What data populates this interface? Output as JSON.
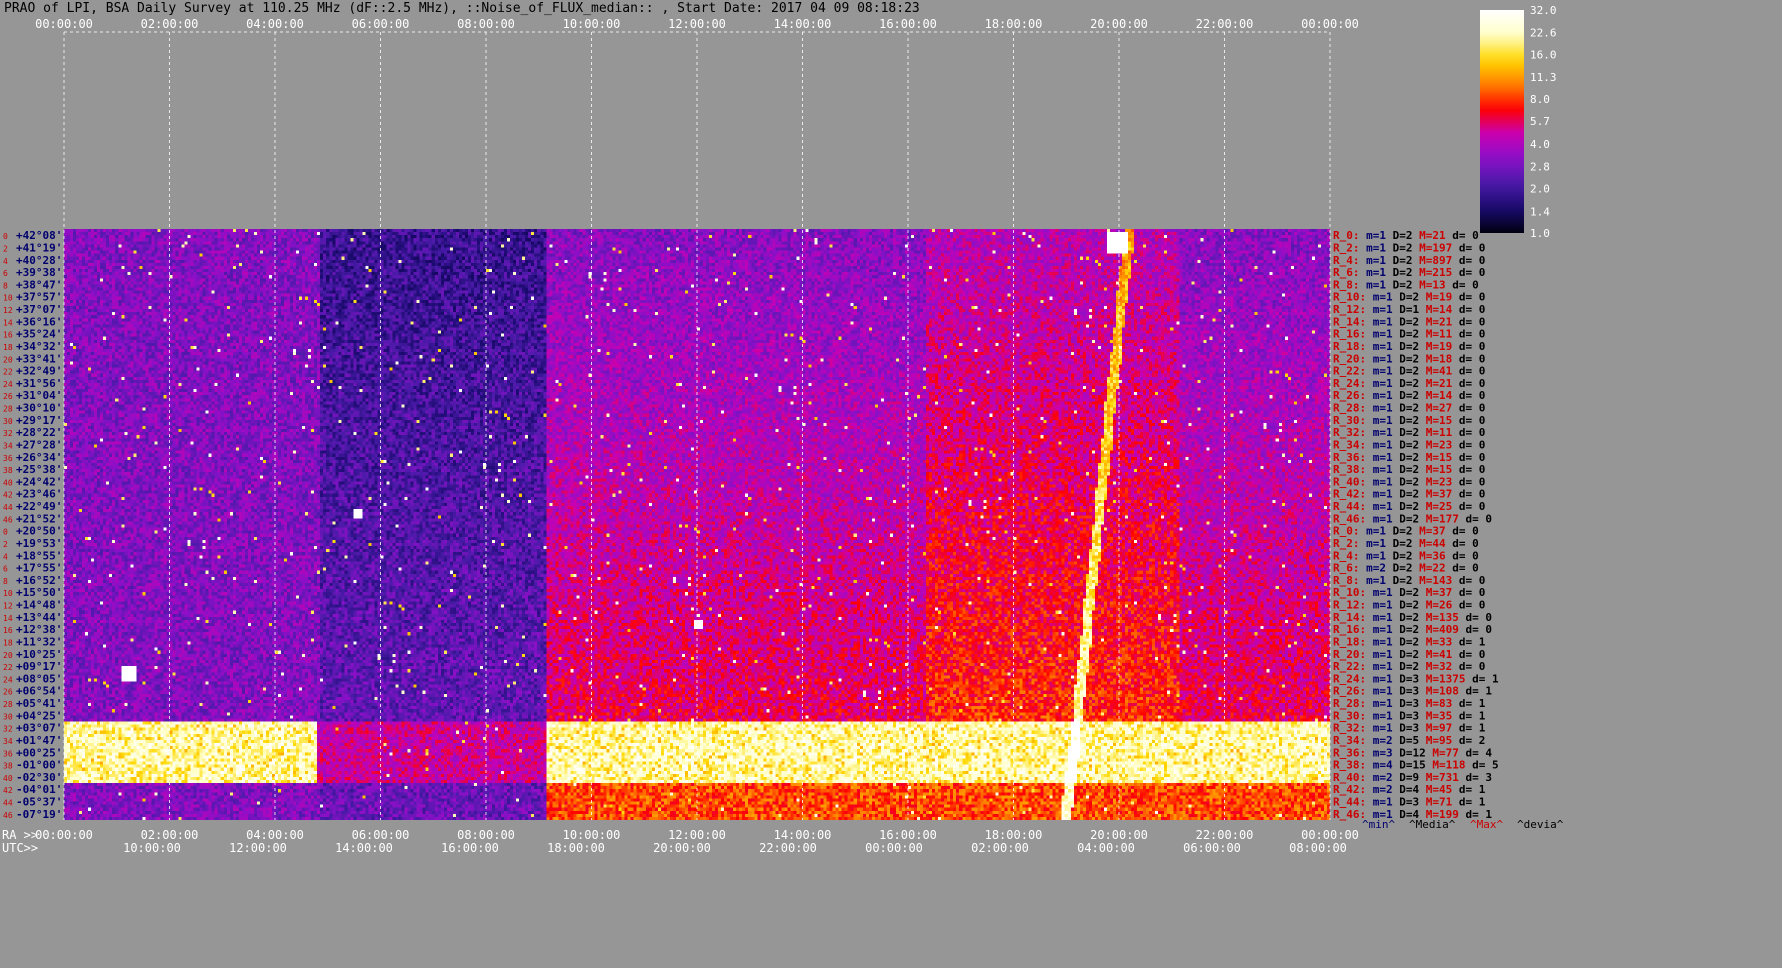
{
  "title": "PRAO of LPI, BSA Daily Survey at 110.25 MHz (dF::2.5 MHz), ::Noise_of_FLUX_median:: , Start Date: 2017 04 09 08:18:23",
  "colors": {
    "background": "#969696",
    "label_red": "#cc0000",
    "label_navy": "#00006e",
    "colorscale": [
      "#000010",
      "#1a0a6e",
      "#4a1aa8",
      "#8a10c8",
      "#c800b4",
      "#ff0000",
      "#ff8000",
      "#ffd800",
      "#ffffc8",
      "#ffffff"
    ]
  },
  "chart_data": {
    "type": "heatmap",
    "title": "PRAO of LPI, BSA Daily Survey at 110.25 MHz (dF::2.5 MHz), ::Noise_of_FLUX_median:: , Start Date: 2017 04 09 08:18:23",
    "x_top_ticks": [
      "00:00:00",
      "02:00:00",
      "04:00:00",
      "06:00:00",
      "08:00:00",
      "10:00:00",
      "12:00:00",
      "14:00:00",
      "16:00:00",
      "18:00:00",
      "20:00:00",
      "22:00:00",
      "00:00:00"
    ],
    "x_ra_label": "RA >>",
    "x_ra_ticks": [
      "00:00:00",
      "02:00:00",
      "04:00:00",
      "06:00:00",
      "08:00:00",
      "10:00:00",
      "12:00:00",
      "14:00:00",
      "16:00:00",
      "18:00:00",
      "20:00:00",
      "22:00:00",
      "00:00:00"
    ],
    "x_utc_label": "UTC>>",
    "x_utc_ticks": [
      "10:00:00",
      "12:00:00",
      "14:00:00",
      "16:00:00",
      "18:00:00",
      "20:00:00",
      "22:00:00",
      "00:00:00",
      "02:00:00",
      "04:00:00",
      "06:00:00",
      "08:00:00"
    ],
    "declinations": [
      "+42°08'",
      "+41°19'",
      "+40°28'",
      "+39°38'",
      "+38°47'",
      "+37°57'",
      "+37°07'",
      "+36°16'",
      "+35°24'",
      "+34°32'",
      "+33°41'",
      "+32°49'",
      "+31°56'",
      "+31°04'",
      "+30°10'",
      "+29°17'",
      "+28°22'",
      "+27°28'",
      "+26°34'",
      "+25°38'",
      "+24°42'",
      "+23°46'",
      "+22°49'",
      "+21°52'",
      "+20°50'",
      "+19°53'",
      "+18°55'",
      "+17°55'",
      "+16°52'",
      "+15°50'",
      "+14°48'",
      "+13°44'",
      "+12°38'",
      "+11°32'",
      "+10°25'",
      "+09°17'",
      "+08°05'",
      "+06°54'",
      "+05°41'",
      "+04°25'",
      "+03°07'",
      "+01°47'",
      "+00°25'",
      "-01°00'",
      "-02°30'",
      "-04°01'",
      "-05°37'",
      "-07°19'"
    ],
    "row_indices": [
      "0",
      "2",
      "4",
      "6",
      "8",
      "10",
      "12",
      "14",
      "16",
      "18",
      "20",
      "22",
      "24",
      "26",
      "28",
      "30",
      "32",
      "34",
      "36",
      "38",
      "40",
      "42",
      "44",
      "46",
      "0",
      "2",
      "4",
      "6",
      "8",
      "10",
      "12",
      "14",
      "16",
      "18",
      "20",
      "22",
      "24",
      "26",
      "28",
      "30",
      "32",
      "34",
      "36",
      "38",
      "40",
      "42",
      "44",
      "46"
    ],
    "colorbar_ticks": [
      "32.0",
      "22.6",
      "16.0",
      "11.3",
      "8.0",
      "5.7",
      "4.0",
      "2.8",
      "2.0",
      "1.4",
      "1.0"
    ],
    "colorbar_range": [
      1.0,
      32.0
    ],
    "colorbar_scale": "log",
    "stats_legend": [
      "^min^",
      "^Media^",
      "^Max^",
      "^devia^"
    ],
    "stats": [
      {
        "r": "R_0:",
        "m": "m=1",
        "D": "D=2",
        "M": "M=21",
        "d": "d= 0"
      },
      {
        "r": "R_2:",
        "m": "m=1",
        "D": "D=2",
        "M": "M=197",
        "d": "d= 0"
      },
      {
        "r": "R_4:",
        "m": "m=1",
        "D": "D=2",
        "M": "M=897",
        "d": "d= 0"
      },
      {
        "r": "R_6:",
        "m": "m=1",
        "D": "D=2",
        "M": "M=215",
        "d": "d= 0"
      },
      {
        "r": "R_8:",
        "m": "m=1",
        "D": "D=2",
        "M": "M=13",
        "d": "d= 0"
      },
      {
        "r": "R_10:",
        "m": "m=1",
        "D": "D=2",
        "M": "M=19",
        "d": "d= 0"
      },
      {
        "r": "R_12:",
        "m": "m=1",
        "D": "D=1",
        "M": "M=14",
        "d": "d= 0"
      },
      {
        "r": "R_14:",
        "m": "m=1",
        "D": "D=2",
        "M": "M=21",
        "d": "d= 0"
      },
      {
        "r": "R_16:",
        "m": "m=1",
        "D": "D=2",
        "M": "M=11",
        "d": "d= 0"
      },
      {
        "r": "R_18:",
        "m": "m=1",
        "D": "D=2",
        "M": "M=19",
        "d": "d= 0"
      },
      {
        "r": "R_20:",
        "m": "m=1",
        "D": "D=2",
        "M": "M=18",
        "d": "d= 0"
      },
      {
        "r": "R_22:",
        "m": "m=1",
        "D": "D=2",
        "M": "M=41",
        "d": "d= 0"
      },
      {
        "r": "R_24:",
        "m": "m=1",
        "D": "D=2",
        "M": "M=21",
        "d": "d= 0"
      },
      {
        "r": "R_26:",
        "m": "m=1",
        "D": "D=2",
        "M": "M=14",
        "d": "d= 0"
      },
      {
        "r": "R_28:",
        "m": "m=1",
        "D": "D=2",
        "M": "M=27",
        "d": "d= 0"
      },
      {
        "r": "R_30:",
        "m": "m=1",
        "D": "D=2",
        "M": "M=15",
        "d": "d= 0"
      },
      {
        "r": "R_32:",
        "m": "m=1",
        "D": "D=2",
        "M": "M=11",
        "d": "d= 0"
      },
      {
        "r": "R_34:",
        "m": "m=1",
        "D": "D=2",
        "M": "M=23",
        "d": "d= 0"
      },
      {
        "r": "R_36:",
        "m": "m=1",
        "D": "D=2",
        "M": "M=15",
        "d": "d= 0"
      },
      {
        "r": "R_38:",
        "m": "m=1",
        "D": "D=2",
        "M": "M=15",
        "d": "d= 0"
      },
      {
        "r": "R_40:",
        "m": "m=1",
        "D": "D=2",
        "M": "M=23",
        "d": "d= 0"
      },
      {
        "r": "R_42:",
        "m": "m=1",
        "D": "D=2",
        "M": "M=37",
        "d": "d= 0"
      },
      {
        "r": "R_44:",
        "m": "m=1",
        "D": "D=2",
        "M": "M=25",
        "d": "d= 0"
      },
      {
        "r": "R_46:",
        "m": "m=1",
        "D": "D=2",
        "M": "M=177",
        "d": "d= 0"
      },
      {
        "r": "R_0:",
        "m": "m=1",
        "D": "D=2",
        "M": "M=37",
        "d": "d= 0"
      },
      {
        "r": "R_2:",
        "m": "m=1",
        "D": "D=2",
        "M": "M=44",
        "d": "d= 0"
      },
      {
        "r": "R_4:",
        "m": "m=1",
        "D": "D=2",
        "M": "M=36",
        "d": "d= 0"
      },
      {
        "r": "R_6:",
        "m": "m=2",
        "D": "D=2",
        "M": "M=22",
        "d": "d= 0"
      },
      {
        "r": "R_8:",
        "m": "m=1",
        "D": "D=2",
        "M": "M=143",
        "d": "d= 0"
      },
      {
        "r": "R_10:",
        "m": "m=1",
        "D": "D=2",
        "M": "M=37",
        "d": "d= 0"
      },
      {
        "r": "R_12:",
        "m": "m=1",
        "D": "D=2",
        "M": "M=26",
        "d": "d= 0"
      },
      {
        "r": "R_14:",
        "m": "m=1",
        "D": "D=2",
        "M": "M=135",
        "d": "d= 0"
      },
      {
        "r": "R_16:",
        "m": "m=1",
        "D": "D=2",
        "M": "M=409",
        "d": "d= 0"
      },
      {
        "r": "R_18:",
        "m": "m=1",
        "D": "D=2",
        "M": "M=33",
        "d": "d= 1"
      },
      {
        "r": "R_20:",
        "m": "m=1",
        "D": "D=2",
        "M": "M=41",
        "d": "d= 0"
      },
      {
        "r": "R_22:",
        "m": "m=1",
        "D": "D=2",
        "M": "M=32",
        "d": "d= 0"
      },
      {
        "r": "R_24:",
        "m": "m=1",
        "D": "D=3",
        "M": "M=1375",
        "d": "d= 1"
      },
      {
        "r": "R_26:",
        "m": "m=1",
        "D": "D=3",
        "M": "M=108",
        "d": "d= 1"
      },
      {
        "r": "R_28:",
        "m": "m=1",
        "D": "D=3",
        "M": "M=83",
        "d": "d= 1"
      },
      {
        "r": "R_30:",
        "m": "m=1",
        "D": "D=3",
        "M": "M=35",
        "d": "d= 1"
      },
      {
        "r": "R_32:",
        "m": "m=1",
        "D": "D=3",
        "M": "M=97",
        "d": "d= 1"
      },
      {
        "r": "R_34:",
        "m": "m=2",
        "D": "D=5",
        "M": "M=95",
        "d": "d= 2"
      },
      {
        "r": "R_36:",
        "m": "m=3",
        "D": "D=12",
        "M": "M=77",
        "d": "d= 4"
      },
      {
        "r": "R_38:",
        "m": "m=4",
        "D": "D=15",
        "M": "M=118",
        "d": "d= 5"
      },
      {
        "r": "R_40:",
        "m": "m=2",
        "D": "D=9",
        "M": "M=731",
        "d": "d= 3"
      },
      {
        "r": "R_42:",
        "m": "m=2",
        "D": "D=4",
        "M": "M=45",
        "d": "d= 1"
      },
      {
        "r": "R_44:",
        "m": "m=1",
        "D": "D=3",
        "M": "M=71",
        "d": "d= 1"
      },
      {
        "r": "R_46:",
        "m": "m=1",
        "D": "D=4",
        "M": "M=199",
        "d": "d= 1"
      }
    ]
  }
}
